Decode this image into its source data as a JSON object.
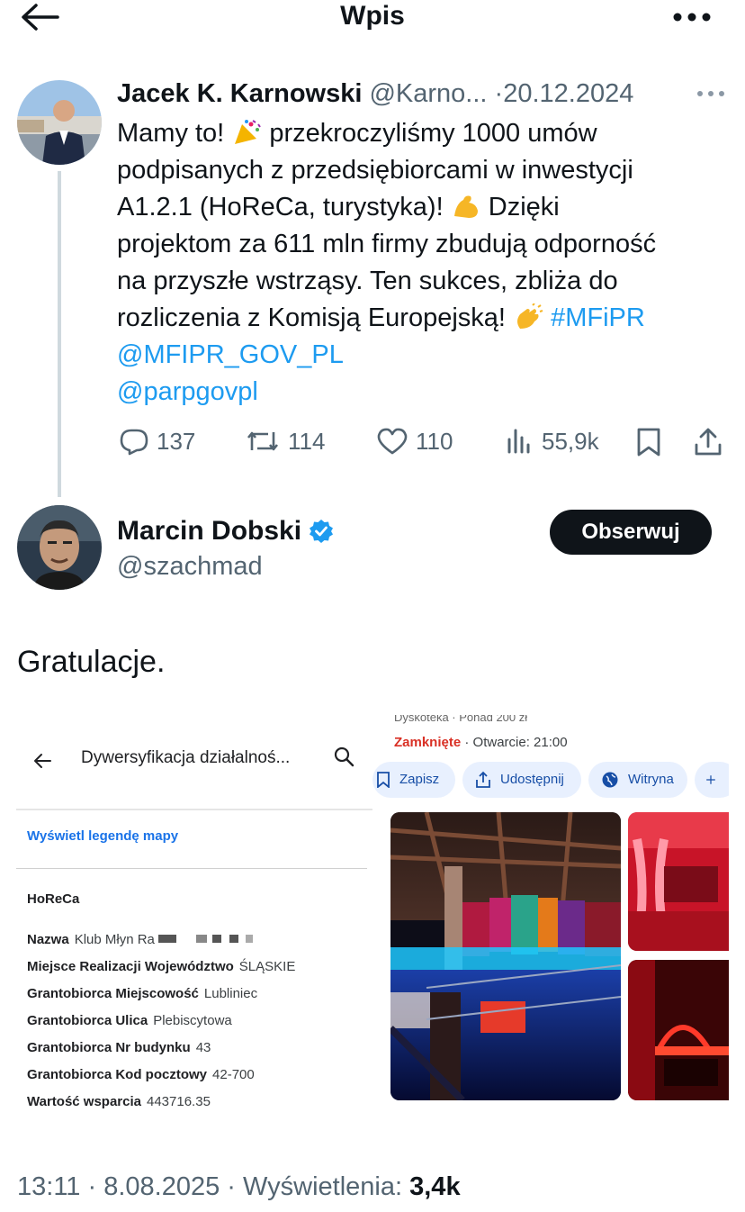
{
  "header": {
    "title": "Wpis"
  },
  "quoted_tweet": {
    "author_name": "Jacek K. Karnowski",
    "handle": "@Karno...",
    "date": "20.12.2024",
    "lines": [
      "Mamy to!",
      "przekroczyliśmy 1000 umów",
      "podpisanych z przedsiębiorcami w inwestycji",
      "A1.2.1 (HoReCa, turystyka)!",
      "Dzięki",
      "projektom za 611 mln firmy zbudują odporność",
      "na przyszłe wstrząsy. Ten sukces, zbliża do",
      "rozliczenia z Komisją Europejską!",
      "#MFiPR",
      "@MFIPR_GOV_PL",
      "@parpgovpl"
    ],
    "stats": {
      "replies": "137",
      "reposts": "114",
      "likes": "110",
      "views": "55,9k"
    }
  },
  "reply": {
    "author_name": "Marcin Dobski",
    "handle": "@szachmad",
    "follow_label": "Obserwuj",
    "text": "Gratulacje."
  },
  "attached_image": {
    "left_panel": {
      "search_text": "Dywersyfikacja działalnoś...",
      "legend_link": "Wyświetl legendę mapy",
      "category": "HoReCa",
      "fields": [
        {
          "key": "Nazwa",
          "value": "Klub Młyn Ra"
        },
        {
          "key": "Miejsce Realizacji Województwo",
          "value": "ŚLĄSKIE"
        },
        {
          "key": "Grantobiorca Miejscowość",
          "value": "Lubliniec"
        },
        {
          "key": "Grantobiorca Ulica",
          "value": "Plebiscytowa"
        },
        {
          "key": "Grantobiorca Nr budynku",
          "value": "43"
        },
        {
          "key": "Grantobiorca Kod pocztowy",
          "value": "42-700"
        },
        {
          "key": "Wartość wsparcia",
          "value": "443716.35"
        }
      ]
    },
    "right_panel": {
      "partial_line": "Dyskoteka · Ponad 200 zł",
      "status_closed": "Zamknięte",
      "status_open": "· Otwarcie: 21:00",
      "chips": [
        "Zapisz",
        "Udostępnij",
        "Witryna"
      ]
    }
  },
  "footer": {
    "time": "13:11",
    "date": "8.08.2025",
    "views_label": "Wyświetlenia:",
    "views_value": "3,4k"
  },
  "colors": {
    "link": "#1d9bf0",
    "text": "#0f1419",
    "muted": "#536471",
    "follow_bg": "#0f1419",
    "closed_red": "#d93025",
    "maps_blue": "#1a73e8"
  }
}
